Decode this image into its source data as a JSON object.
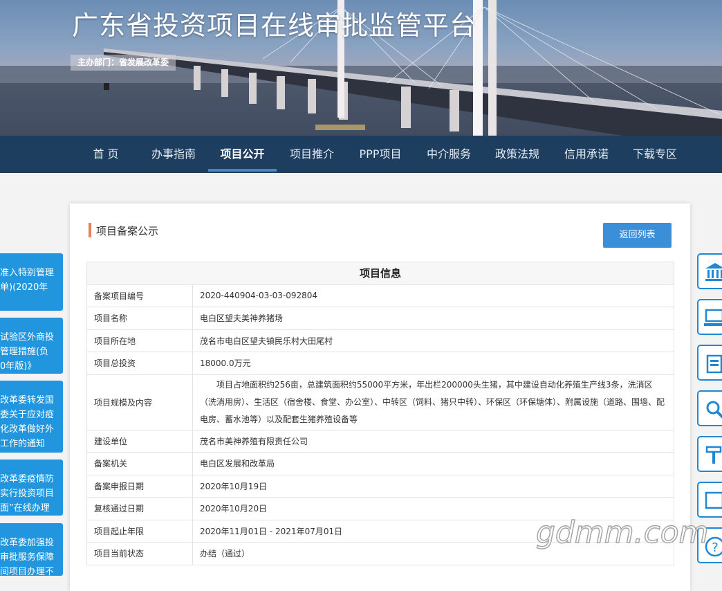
{
  "header": {
    "site_title": "广东省投资项目在线审批监管平台",
    "sponsor": "主办部门：省发展改革委"
  },
  "nav": {
    "items": [
      {
        "label": "首 页"
      },
      {
        "label": "办事指南"
      },
      {
        "label": "项目公开",
        "active": true
      },
      {
        "label": "项目推介"
      },
      {
        "label": "PPP项目"
      },
      {
        "label": "中介服务"
      },
      {
        "label": "政策法规"
      },
      {
        "label": "信用承诺"
      },
      {
        "label": "下载专区"
      }
    ]
  },
  "left_links": [
    {
      "lines": [
        "准入特别管理",
        "单)(2020年"
      ]
    },
    {
      "lines": [
        "试验区外商投",
        "管理措施(负",
        "0年版)》"
      ]
    },
    {
      "lines": [
        "改革委转发国",
        "委关于应对疫",
        "化改革做好外",
        "工作的通知"
      ]
    },
    {
      "lines": [
        "改革委疫情防",
        "实行投资项目",
        "面”在线办理"
      ]
    },
    {
      "lines": [
        "改革委加强投",
        "审批服务保障",
        "间项目办理不"
      ]
    }
  ],
  "panel": {
    "title": "项目备案公示",
    "back_button": "返回列表",
    "table_heading": "项目信息",
    "rows": [
      {
        "key": "备案项目编号",
        "value": "2020-440904-03-03-092804"
      },
      {
        "key": "项目名称",
        "value": "电白区望夫美神养猪场"
      },
      {
        "key": "项目所在地",
        "value": "茂名市电白区望夫镇民乐村大田尾村"
      },
      {
        "key": "项目总投资",
        "value": "18000.0万元"
      },
      {
        "key": "项目规模及内容",
        "value": "项目占地面积约256亩，总建筑面积约55000平方米，年出栏200000头生猪，其中建设自动化养殖生产线3条，洗消区（洗消用房）、生活区（宿舍楼、食堂、办公室）、中转区（饲料、猪只中转）、环保区（环保塘体）、附属设施（道路、围墙、配电房、蓄水池等）以及配套生猪养殖设备等"
      },
      {
        "key": "建设单位",
        "value": "茂名市美神养殖有限责任公司"
      },
      {
        "key": "备案机关",
        "value": "电白区发展和改革局"
      },
      {
        "key": "备案申报日期",
        "value": "2020年10月19日"
      },
      {
        "key": "复核通过日期",
        "value": "2020年10月20日"
      },
      {
        "key": "项目起止年限",
        "value": "2020年11月01日 - 2021年07月01日"
      },
      {
        "key": "项目当前状态",
        "value": "办结（通过）"
      }
    ]
  },
  "right_icons": [
    "building-icon",
    "computer-icon",
    "document-icon",
    "search-icon",
    "tools-icon",
    "box-icon",
    "help-icon"
  ],
  "watermark": "gdmm.com",
  "colors": {
    "nav_bg": "#1d3e5f",
    "accent": "#3b8fd9",
    "left_link_bg": "#2196de",
    "title_marker": "#e9805a"
  }
}
